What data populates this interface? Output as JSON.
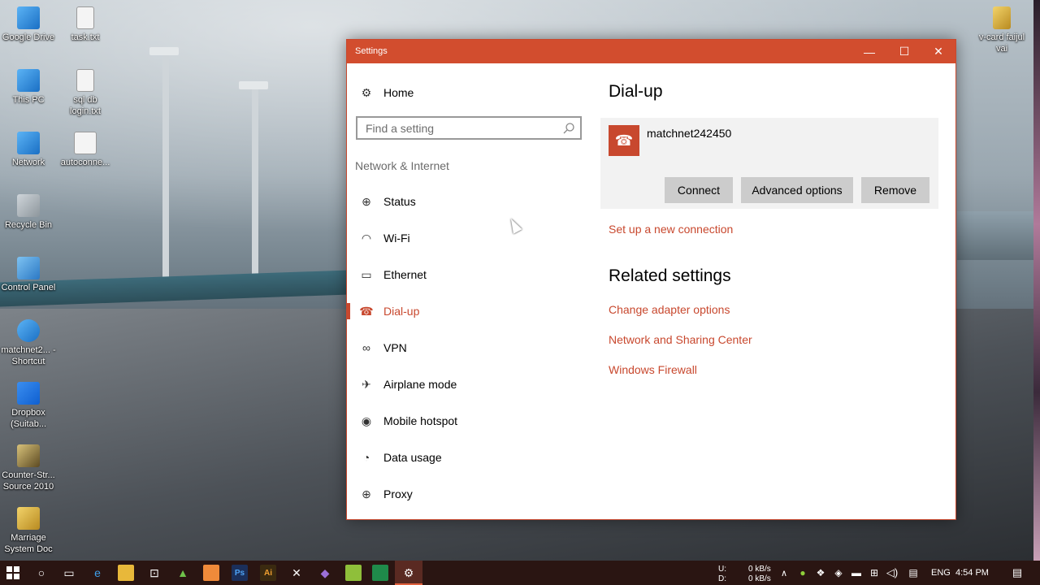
{
  "desktop": {
    "icons_left": [
      {
        "label": "Google Drive",
        "icon": "google-drive-icon"
      },
      {
        "label": "This PC",
        "icon": "this-pc-icon"
      },
      {
        "label": "Network",
        "icon": "network-icon"
      },
      {
        "label": "Recycle Bin",
        "icon": "recycle-bin-icon"
      },
      {
        "label": "Control Panel",
        "icon": "control-panel-icon"
      },
      {
        "label": "matchnet2... - Shortcut",
        "icon": "shortcut-icon"
      },
      {
        "label": "Dropbox (Suitab...",
        "icon": "dropbox-icon"
      },
      {
        "label": "Counter-Str... Source 2010",
        "icon": "game-icon"
      },
      {
        "label": "Marriage System Doc",
        "icon": "zip-icon"
      }
    ],
    "icons_second": [
      {
        "label": "task.txt",
        "icon": "text-file-icon"
      },
      {
        "label": "sql db login.txt",
        "icon": "text-file-icon"
      },
      {
        "label": "autoconne...",
        "icon": "file-icon"
      }
    ],
    "icons_right": [
      {
        "label": "v-card faijul vai",
        "icon": "zip-icon"
      }
    ]
  },
  "window": {
    "title": "Settings",
    "controls": {
      "minimize": "—",
      "maximize": "☐",
      "close": "✕"
    }
  },
  "nav": {
    "home": "Home",
    "search_placeholder": "Find a setting",
    "group": "Network & Internet",
    "items": [
      {
        "label": "Status",
        "icon": "globe-icon",
        "glyph": "⊕"
      },
      {
        "label": "Wi-Fi",
        "icon": "wifi-icon",
        "glyph": "◠"
      },
      {
        "label": "Ethernet",
        "icon": "ethernet-icon",
        "glyph": "▭"
      },
      {
        "label": "Dial-up",
        "icon": "phone-icon",
        "glyph": "☎",
        "active": true
      },
      {
        "label": "VPN",
        "icon": "vpn-icon",
        "glyph": "∞"
      },
      {
        "label": "Airplane mode",
        "icon": "airplane-icon",
        "glyph": "✈"
      },
      {
        "label": "Mobile hotspot",
        "icon": "hotspot-icon",
        "glyph": "◉"
      },
      {
        "label": "Data usage",
        "icon": "data-usage-icon",
        "glyph": "◔"
      },
      {
        "label": "Proxy",
        "icon": "proxy-icon",
        "glyph": "⊕"
      }
    ]
  },
  "content": {
    "title": "Dial-up",
    "connection_name": "matchnet242450",
    "buttons": {
      "connect": "Connect",
      "advanced": "Advanced options",
      "remove": "Remove"
    },
    "setup_link": "Set up a new connection",
    "related_title": "Related settings",
    "related_links": [
      "Change adapter options",
      "Network and Sharing Center",
      "Windows Firewall"
    ]
  },
  "taskbar": {
    "tray_drive_labels": [
      "U:",
      "D:"
    ],
    "tray_speeds": [
      "0 kB/s",
      "0 kB/s"
    ],
    "language": "ENG",
    "time": "4:54 PM"
  },
  "colors": {
    "accent": "#c8482e",
    "titlebar": "#d24d2e",
    "taskbar": "#2a1512"
  }
}
